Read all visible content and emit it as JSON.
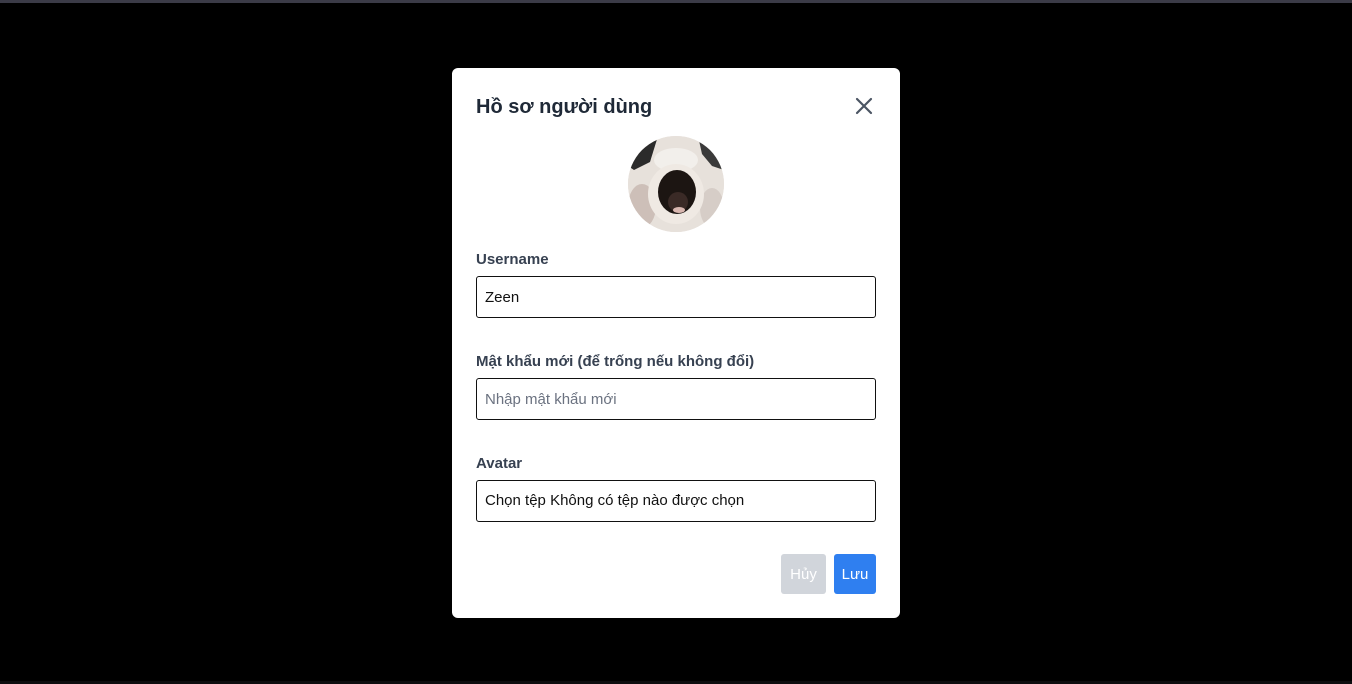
{
  "modal": {
    "title": "Hồ sơ người dùng",
    "close_icon": "close-icon"
  },
  "avatar": {
    "icon": "avatar-image"
  },
  "fields": {
    "username": {
      "label": "Username",
      "value": "Zeen"
    },
    "password": {
      "label": "Mật khẩu mới (để trống nếu không đổi)",
      "value": "",
      "placeholder": "Nhập mật khẩu mới"
    },
    "avatar_file": {
      "label": "Avatar",
      "button_label": "Chọn tệp",
      "status": "Không có tệp nào được chọn"
    }
  },
  "buttons": {
    "cancel_label": "Hủy",
    "save_label": "Lưu"
  },
  "colors": {
    "backdrop": "#000000",
    "panel": "#ffffff",
    "cancel_button": "#d1d5db",
    "save_button": "#2f7ff0"
  }
}
